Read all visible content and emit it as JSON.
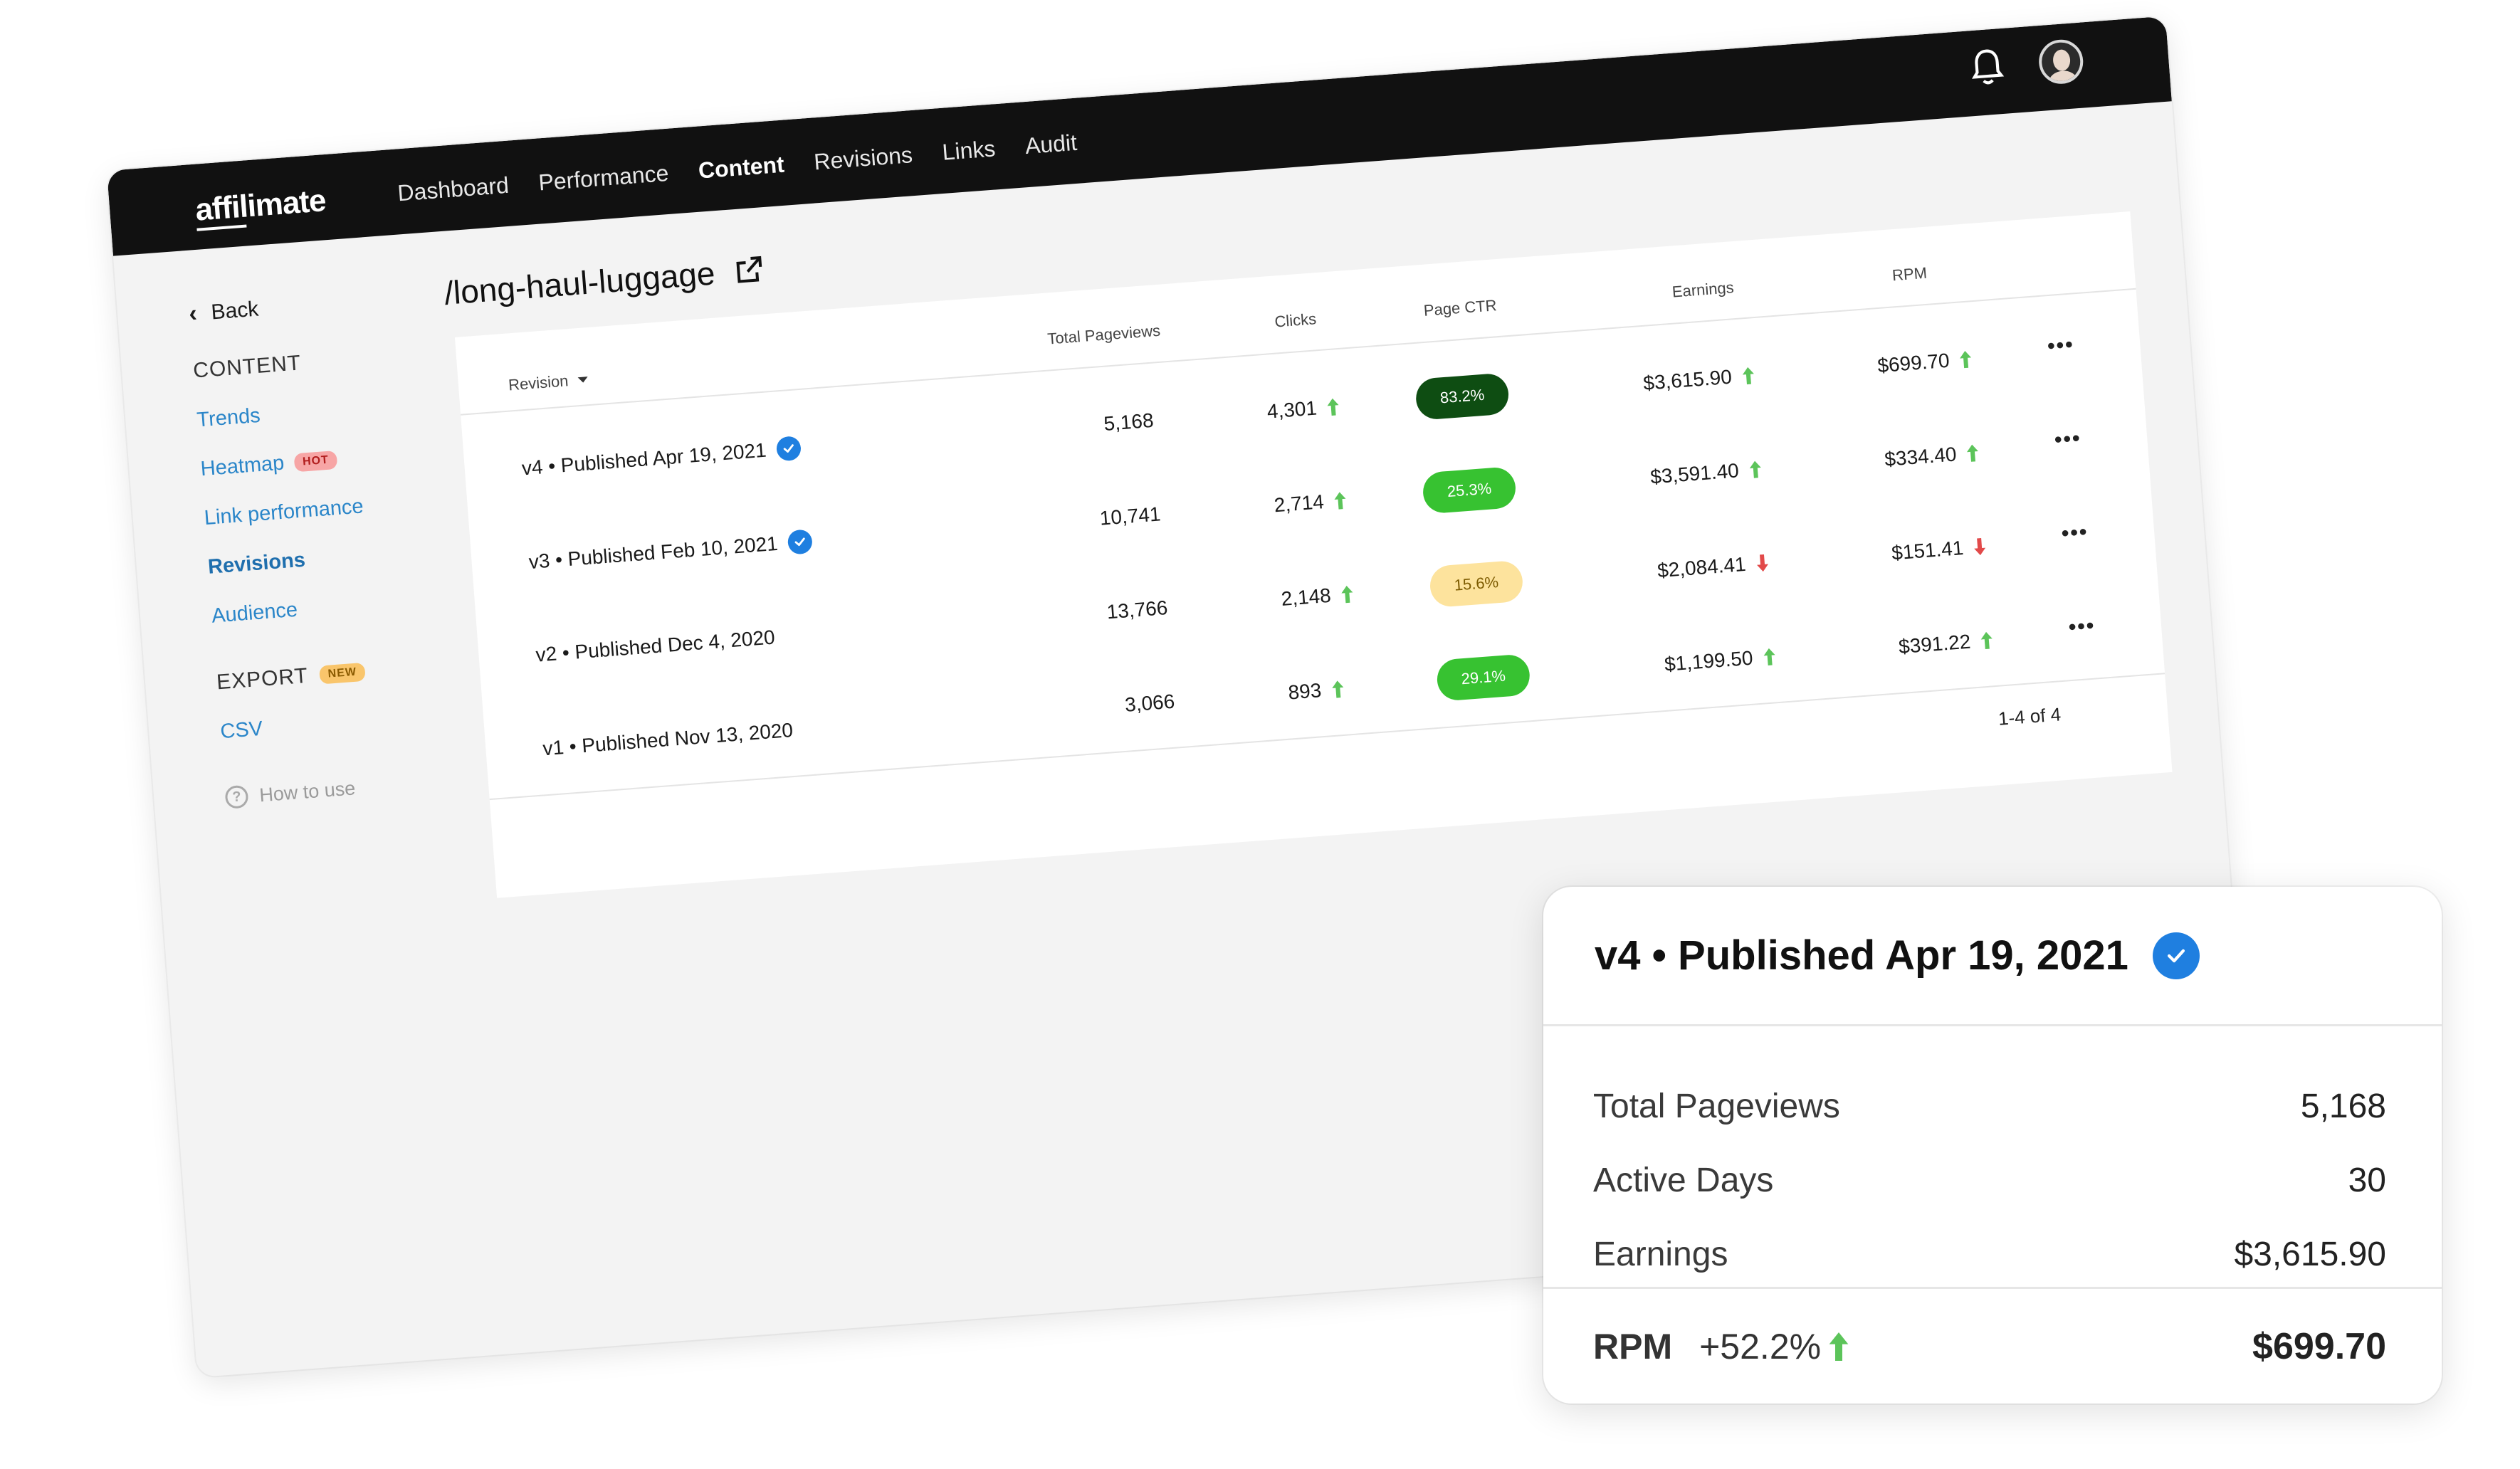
{
  "app": {
    "logo": "affilimate",
    "nav": [
      "Dashboard",
      "Performance",
      "Content",
      "Revisions",
      "Links",
      "Audit"
    ],
    "active_nav": "Content"
  },
  "sidebar": {
    "back_label": "Back",
    "content_heading": "CONTENT",
    "items": [
      {
        "label": "Trends"
      },
      {
        "label": "Heatmap",
        "badge": "HOT"
      },
      {
        "label": "Link performance"
      },
      {
        "label": "Revisions"
      },
      {
        "label": "Audience"
      }
    ],
    "export_heading": "EXPORT",
    "export_badge": "NEW",
    "export_items": [
      {
        "label": "CSV"
      }
    ],
    "help_label": "How to use"
  },
  "page": {
    "title": "/long-haul-luggage"
  },
  "table": {
    "headers": {
      "revision": "Revision",
      "pageviews": "Total Pageviews",
      "clicks": "Clicks",
      "ctr": "Page CTR",
      "earnings": "Earnings",
      "rpm": "RPM"
    },
    "rows": [
      {
        "revision": "v4 • Published Apr 19, 2021",
        "verified": true,
        "pageviews": "5,168",
        "clicks": "4,301",
        "clicks_trend": "up",
        "ctr": "83.2%",
        "ctr_style": "dark",
        "earnings": "$3,615.90",
        "earnings_trend": "up",
        "rpm": "$699.70",
        "rpm_trend": "up"
      },
      {
        "revision": "v3 • Published Feb 10, 2021",
        "verified": true,
        "pageviews": "10,741",
        "clicks": "2,714",
        "clicks_trend": "up",
        "ctr": "25.3%",
        "ctr_style": "green",
        "earnings": "$3,591.40",
        "earnings_trend": "up",
        "rpm": "$334.40",
        "rpm_trend": "up"
      },
      {
        "revision": "v2 • Published Dec 4, 2020",
        "verified": false,
        "pageviews": "13,766",
        "clicks": "2,148",
        "clicks_trend": "up",
        "ctr": "15.6%",
        "ctr_style": "yellow",
        "earnings": "$2,084.41",
        "earnings_trend": "down",
        "rpm": "$151.41",
        "rpm_trend": "down"
      },
      {
        "revision": "v1 • Published Nov 13, 2020",
        "verified": false,
        "pageviews": "3,066",
        "clicks": "893",
        "clicks_trend": "up",
        "ctr": "29.1%",
        "ctr_style": "green",
        "earnings": "$1,199.50",
        "earnings_trend": "up",
        "rpm": "$391.22",
        "rpm_trend": "up"
      }
    ],
    "pager": "1-4 of 4"
  },
  "detail": {
    "title": "v4 • Published Apr 19, 2021",
    "stats": [
      {
        "label": "Total Pageviews",
        "value": "5,168"
      },
      {
        "label": "Active Days",
        "value": "30"
      },
      {
        "label": "Earnings",
        "value": "$3,615.90"
      }
    ],
    "rpm_label": "RPM",
    "rpm_change": "+52.2%",
    "rpm_value": "$699.70"
  },
  "colors": {
    "topbar": "#111111",
    "link": "#2b86c9",
    "check": "#1f7fe0",
    "up": "#5cc45a",
    "down": "#e24a4a",
    "ctr_dark": "#0e4d12",
    "ctr_green": "#37c231",
    "ctr_yellow": "#fde39d"
  }
}
